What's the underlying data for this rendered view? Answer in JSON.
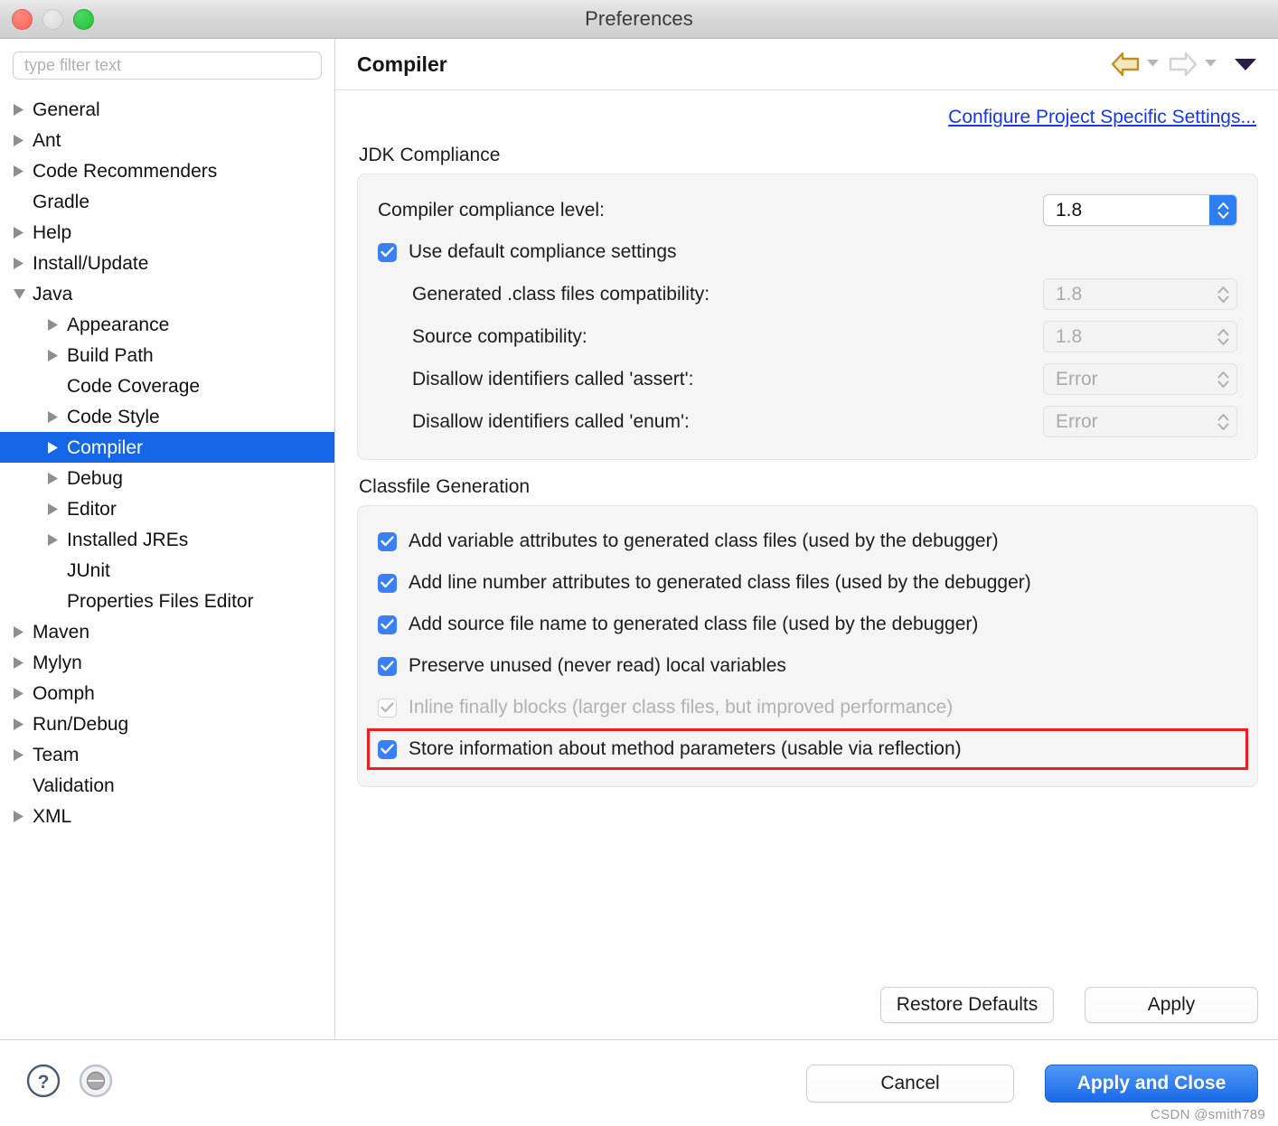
{
  "window": {
    "title": "Preferences",
    "traffic_lights": [
      "close",
      "minimize",
      "maximize"
    ]
  },
  "sidebar": {
    "filter_placeholder": "type filter text",
    "filter_value": "",
    "tree": [
      {
        "label": "General",
        "depth": 1,
        "twisty": "right",
        "selected": false
      },
      {
        "label": "Ant",
        "depth": 1,
        "twisty": "right",
        "selected": false
      },
      {
        "label": "Code Recommenders",
        "depth": 1,
        "twisty": "right",
        "selected": false
      },
      {
        "label": "Gradle",
        "depth": 1,
        "twisty": "none",
        "selected": false
      },
      {
        "label": "Help",
        "depth": 1,
        "twisty": "right",
        "selected": false
      },
      {
        "label": "Install/Update",
        "depth": 1,
        "twisty": "right",
        "selected": false
      },
      {
        "label": "Java",
        "depth": 1,
        "twisty": "down",
        "selected": false
      },
      {
        "label": "Appearance",
        "depth": 2,
        "twisty": "right",
        "selected": false
      },
      {
        "label": "Build Path",
        "depth": 2,
        "twisty": "right",
        "selected": false
      },
      {
        "label": "Code Coverage",
        "depth": 2,
        "twisty": "none",
        "selected": false
      },
      {
        "label": "Code Style",
        "depth": 2,
        "twisty": "right",
        "selected": false
      },
      {
        "label": "Compiler",
        "depth": 2,
        "twisty": "right",
        "selected": true
      },
      {
        "label": "Debug",
        "depth": 2,
        "twisty": "right",
        "selected": false
      },
      {
        "label": "Editor",
        "depth": 2,
        "twisty": "right",
        "selected": false
      },
      {
        "label": "Installed JREs",
        "depth": 2,
        "twisty": "right",
        "selected": false
      },
      {
        "label": "JUnit",
        "depth": 2,
        "twisty": "none",
        "selected": false
      },
      {
        "label": "Properties Files Editor",
        "depth": 2,
        "twisty": "none",
        "selected": false
      },
      {
        "label": "Maven",
        "depth": 1,
        "twisty": "right",
        "selected": false
      },
      {
        "label": "Mylyn",
        "depth": 1,
        "twisty": "right",
        "selected": false
      },
      {
        "label": "Oomph",
        "depth": 1,
        "twisty": "right",
        "selected": false
      },
      {
        "label": "Run/Debug",
        "depth": 1,
        "twisty": "right",
        "selected": false
      },
      {
        "label": "Team",
        "depth": 1,
        "twisty": "right",
        "selected": false
      },
      {
        "label": "Validation",
        "depth": 1,
        "twisty": "none",
        "selected": false
      },
      {
        "label": "XML",
        "depth": 1,
        "twisty": "right",
        "selected": false
      }
    ]
  },
  "header": {
    "title": "Compiler",
    "nav": {
      "back_icon": "back-arrow-icon",
      "back_enabled": true,
      "forward_icon": "forward-arrow-icon",
      "forward_enabled": false,
      "menu_icon": "chevron-down-icon"
    }
  },
  "main": {
    "configure_link": "Configure Project Specific Settings...",
    "jdk_compliance": {
      "title": "JDK Compliance",
      "compliance_level": {
        "label": "Compiler compliance level:",
        "value": "1.8",
        "enabled": true
      },
      "use_defaults": {
        "label": "Use default compliance settings",
        "checked": true,
        "enabled": true
      },
      "fields": [
        {
          "label": "Generated .class files compatibility:",
          "value": "1.8",
          "enabled": false
        },
        {
          "label": "Source compatibility:",
          "value": "1.8",
          "enabled": false
        },
        {
          "label": "Disallow identifiers called 'assert':",
          "value": "Error",
          "enabled": false
        },
        {
          "label": "Disallow identifiers called 'enum':",
          "value": "Error",
          "enabled": false
        }
      ]
    },
    "classfile_generation": {
      "title": "Classfile Generation",
      "options": [
        {
          "label": "Add variable attributes to generated class files (used by the debugger)",
          "checked": true,
          "enabled": true,
          "highlighted": false
        },
        {
          "label": "Add line number attributes to generated class files (used by the debugger)",
          "checked": true,
          "enabled": true,
          "highlighted": false
        },
        {
          "label": "Add source file name to generated class file (used by the debugger)",
          "checked": true,
          "enabled": true,
          "highlighted": false
        },
        {
          "label": "Preserve unused (never read) local variables",
          "checked": true,
          "enabled": true,
          "highlighted": false
        },
        {
          "label": "Inline finally blocks (larger class files, but improved performance)",
          "checked": true,
          "enabled": false,
          "highlighted": false
        },
        {
          "label": "Store information about method parameters (usable via reflection)",
          "checked": true,
          "enabled": true,
          "highlighted": true
        }
      ]
    },
    "panel_buttons": {
      "restore_defaults": "Restore Defaults",
      "apply": "Apply"
    }
  },
  "footer": {
    "help_icon": "help-circle-icon",
    "transfer_icon": "import-export-circle-icon",
    "cancel": "Cancel",
    "apply_and_close": "Apply and Close"
  },
  "watermark": "CSDN @smith789",
  "colors": {
    "selection_blue": "#1667e8",
    "checkbox_blue": "#3b7ff5",
    "link_blue": "#1538ef",
    "primary_button_blue": "#1a6ae8",
    "highlight_red": "#ef1d1d",
    "panel_bg": "#f5f5f5",
    "back_arrow_gold": "#c79a2c"
  }
}
